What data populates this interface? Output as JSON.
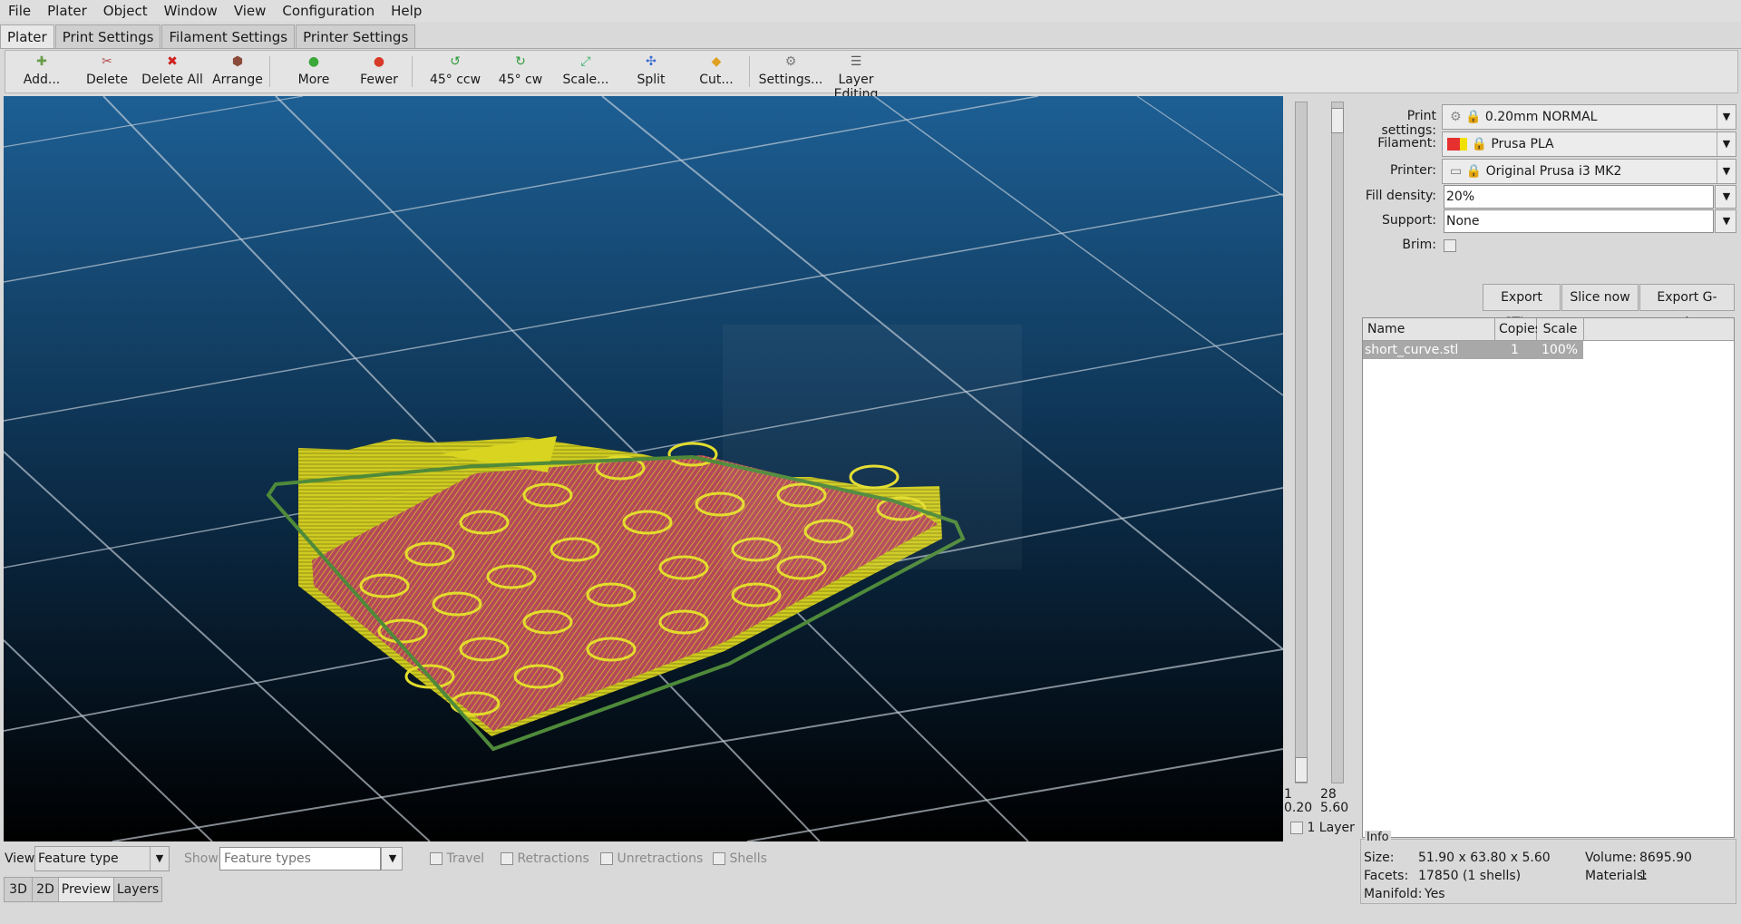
{
  "menu": [
    "File",
    "Plater",
    "Object",
    "Window",
    "View",
    "Configuration",
    "Help"
  ],
  "tabs": [
    "Plater",
    "Print Settings",
    "Filament Settings",
    "Printer Settings"
  ],
  "toolbar": [
    {
      "label": "Add...",
      "icon": "add-icon",
      "glyph": "✚",
      "color": "#6a9c4a"
    },
    {
      "label": "Delete",
      "icon": "delete-icon",
      "glyph": "✂",
      "color": "#b04a4a"
    },
    {
      "label": "Delete All",
      "icon": "delete-all-icon",
      "glyph": "✖",
      "color": "#d02020"
    },
    {
      "label": "Arrange",
      "icon": "arrange-icon",
      "glyph": "⬢",
      "color": "#8a4a3a"
    },
    {
      "label": "More",
      "icon": "add-copy-icon",
      "glyph": "●",
      "color": "#3aa83a"
    },
    {
      "label": "Fewer",
      "icon": "remove-copy-icon",
      "glyph": "●",
      "color": "#d83a2a"
    },
    {
      "label": "45° ccw",
      "icon": "rotate-ccw-icon",
      "glyph": "↺",
      "color": "#2f9a3a"
    },
    {
      "label": "45° cw",
      "icon": "rotate-cw-icon",
      "glyph": "↻",
      "color": "#2f9a3a"
    },
    {
      "label": "Scale...",
      "icon": "scale-icon",
      "glyph": "⤢",
      "color": "#3ab06a"
    },
    {
      "label": "Split",
      "icon": "split-icon",
      "glyph": "✣",
      "color": "#3a6ad0"
    },
    {
      "label": "Cut...",
      "icon": "cut-icon",
      "glyph": "◆",
      "color": "#e0a020"
    },
    {
      "label": "Settings...",
      "icon": "settings-icon",
      "glyph": "⚙",
      "color": "#7a7a7a"
    },
    {
      "label": "Layer Editing",
      "icon": "layer-editing-icon",
      "glyph": "☰",
      "color": "#5a5a5a"
    }
  ],
  "slider": {
    "bottom_layer": "1",
    "bottom_height": "0.20",
    "top_layer": "28",
    "top_height": "5.60",
    "one_layer_label": "1 Layer"
  },
  "settings": {
    "print_label": "Print settings:",
    "print_value": "0.20mm NORMAL",
    "filament_label": "Filament:",
    "filament_value": "Prusa PLA",
    "filament_colors": [
      "#e63030",
      "#f2e000"
    ],
    "printer_label": "Printer:",
    "printer_value": "Original Prusa i3 MK2",
    "fill_label": "Fill density:",
    "fill_value": "20%",
    "support_label": "Support:",
    "support_value": "None",
    "brim_label": "Brim:"
  },
  "actions": {
    "export_stl": "Export STL...",
    "slice_now": "Slice now",
    "export_gcode": "Export G-code..."
  },
  "objects": {
    "headers": [
      "Name",
      "Copies",
      "Scale"
    ],
    "rows": [
      {
        "name": "short_curve.stl",
        "copies": "1",
        "scale": "100%"
      }
    ]
  },
  "info": {
    "title": "Info",
    "size_label": "Size:",
    "size_value": "51.90 x 63.80 x 5.60",
    "volume_label": "Volume:",
    "volume_value": "8695.90",
    "facets_label": "Facets:",
    "facets_value": "17850 (1 shells)",
    "materials_label": "Materials:",
    "materials_value": "1",
    "manifold_label": "Manifold:",
    "manifold_value": "Yes"
  },
  "preview_bar": {
    "view_label": "View",
    "view_value": "Feature type",
    "show_label": "Show",
    "show_placeholder": "Feature types",
    "travel": "Travel",
    "retractions": "Retractions",
    "unretractions": "Unretractions",
    "shells": "Shells"
  },
  "view_tabs": [
    "3D",
    "2D",
    "Preview",
    "Layers"
  ],
  "colors": {
    "bed_top": "#1d5f94",
    "bed_bottom": "#000000",
    "model_yellow": "#d7d21c",
    "model_infill": "#a8404c",
    "skirt_green": "#4f8a3a"
  }
}
